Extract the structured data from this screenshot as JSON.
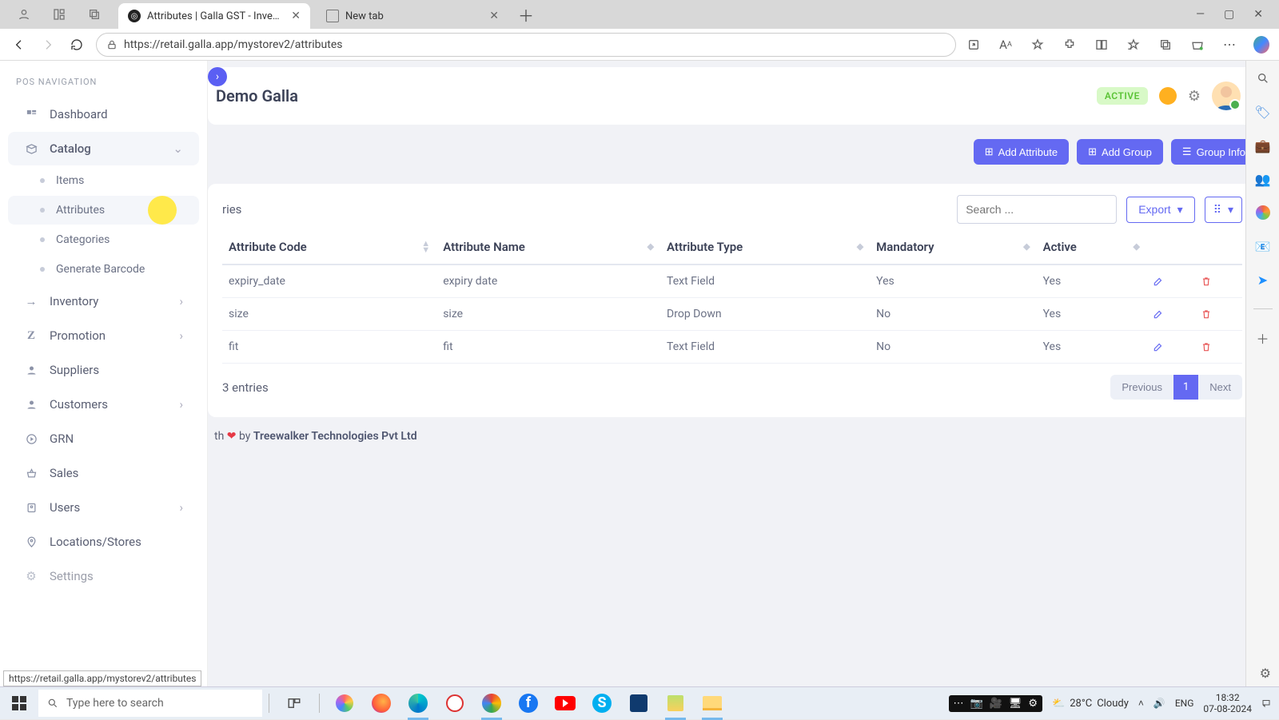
{
  "browser": {
    "tabs": [
      {
        "title": "Attributes | Galla GST - Inventory"
      },
      {
        "title": "New tab"
      }
    ],
    "url": "https://retail.galla.app/mystorev2/attributes"
  },
  "sidebar": {
    "title": "POS NAVIGATION",
    "items": {
      "dashboard": "Dashboard",
      "catalog": "Catalog",
      "catalog_sub": {
        "items": "Items",
        "attributes": "Attributes",
        "categories": "Categories",
        "generate_barcode": "Generate Barcode"
      },
      "inventory": "Inventory",
      "promotion": "Promotion",
      "suppliers": "Suppliers",
      "customers": "Customers",
      "grn": "GRN",
      "sales": "Sales",
      "users": "Users",
      "locations": "Locations/Stores",
      "settings": "Settings"
    }
  },
  "header": {
    "store_name": "Demo Galla",
    "status": "ACTIVE"
  },
  "actions": {
    "add_attribute": "Add Attribute",
    "add_group": "Add Group",
    "group_info": "Group Info"
  },
  "table_controls": {
    "entries_label": "ries",
    "search_placeholder": "Search ...",
    "export": "Export"
  },
  "table": {
    "headers": {
      "code": "Attribute Code",
      "name": "Attribute Name",
      "type": "Attribute Type",
      "mandatory": "Mandatory",
      "active": "Active"
    },
    "rows": [
      {
        "code": "expiry_date",
        "name": "expiry date",
        "type": "Text Field",
        "mandatory": "Yes",
        "active": "Yes"
      },
      {
        "code": "size",
        "name": "size",
        "type": "Drop Down",
        "mandatory": "No",
        "active": "Yes"
      },
      {
        "code": "fit",
        "name": "fit",
        "type": "Text Field",
        "mandatory": "No",
        "active": "Yes"
      }
    ]
  },
  "table_footer": {
    "info": "3 entries",
    "prev": "Previous",
    "page": "1",
    "next": "Next"
  },
  "footer": {
    "prefix": "th ",
    "by": " by ",
    "company": "Treewalker Technologies Pvt Ltd"
  },
  "status_link": "https://retail.galla.app/mystorev2/attributes",
  "taskbar": {
    "search_placeholder": "Type here to search",
    "weather_temp": "28°C",
    "weather_cond": "Cloudy",
    "lang": "ENG",
    "time": "18:32",
    "date": "07-08-2024"
  }
}
